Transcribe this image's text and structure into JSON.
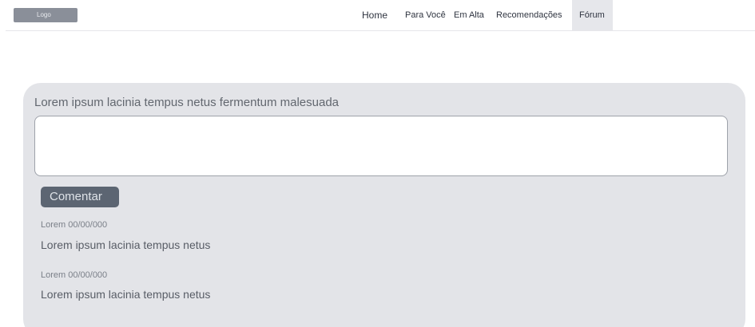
{
  "header": {
    "logo_label": "Logo",
    "nav": {
      "home": "Home",
      "para_voce": "Para Você",
      "em_alta": "Em Alta",
      "recomendacoes": "Recomendações",
      "forum": "Fórum"
    },
    "active_nav": "Fórum"
  },
  "forum": {
    "prompt": "Lorem ipsum lacinia tempus netus fermentum malesuada",
    "comment_input": {
      "value": "",
      "placeholder": ""
    },
    "submit_label": "Comentar",
    "posts": [
      {
        "meta": "Lorem 00/00/000",
        "text": "Lorem ipsum lacinia tempus netus"
      },
      {
        "meta": "Lorem 00/00/000",
        "text": "Lorem ipsum lacinia tempus netus"
      }
    ]
  },
  "colors": {
    "card_background": "#e3e4e8",
    "button_background": "#5c6572",
    "logo_background": "#8a8f99",
    "active_nav_background": "#e6e7eb"
  }
}
